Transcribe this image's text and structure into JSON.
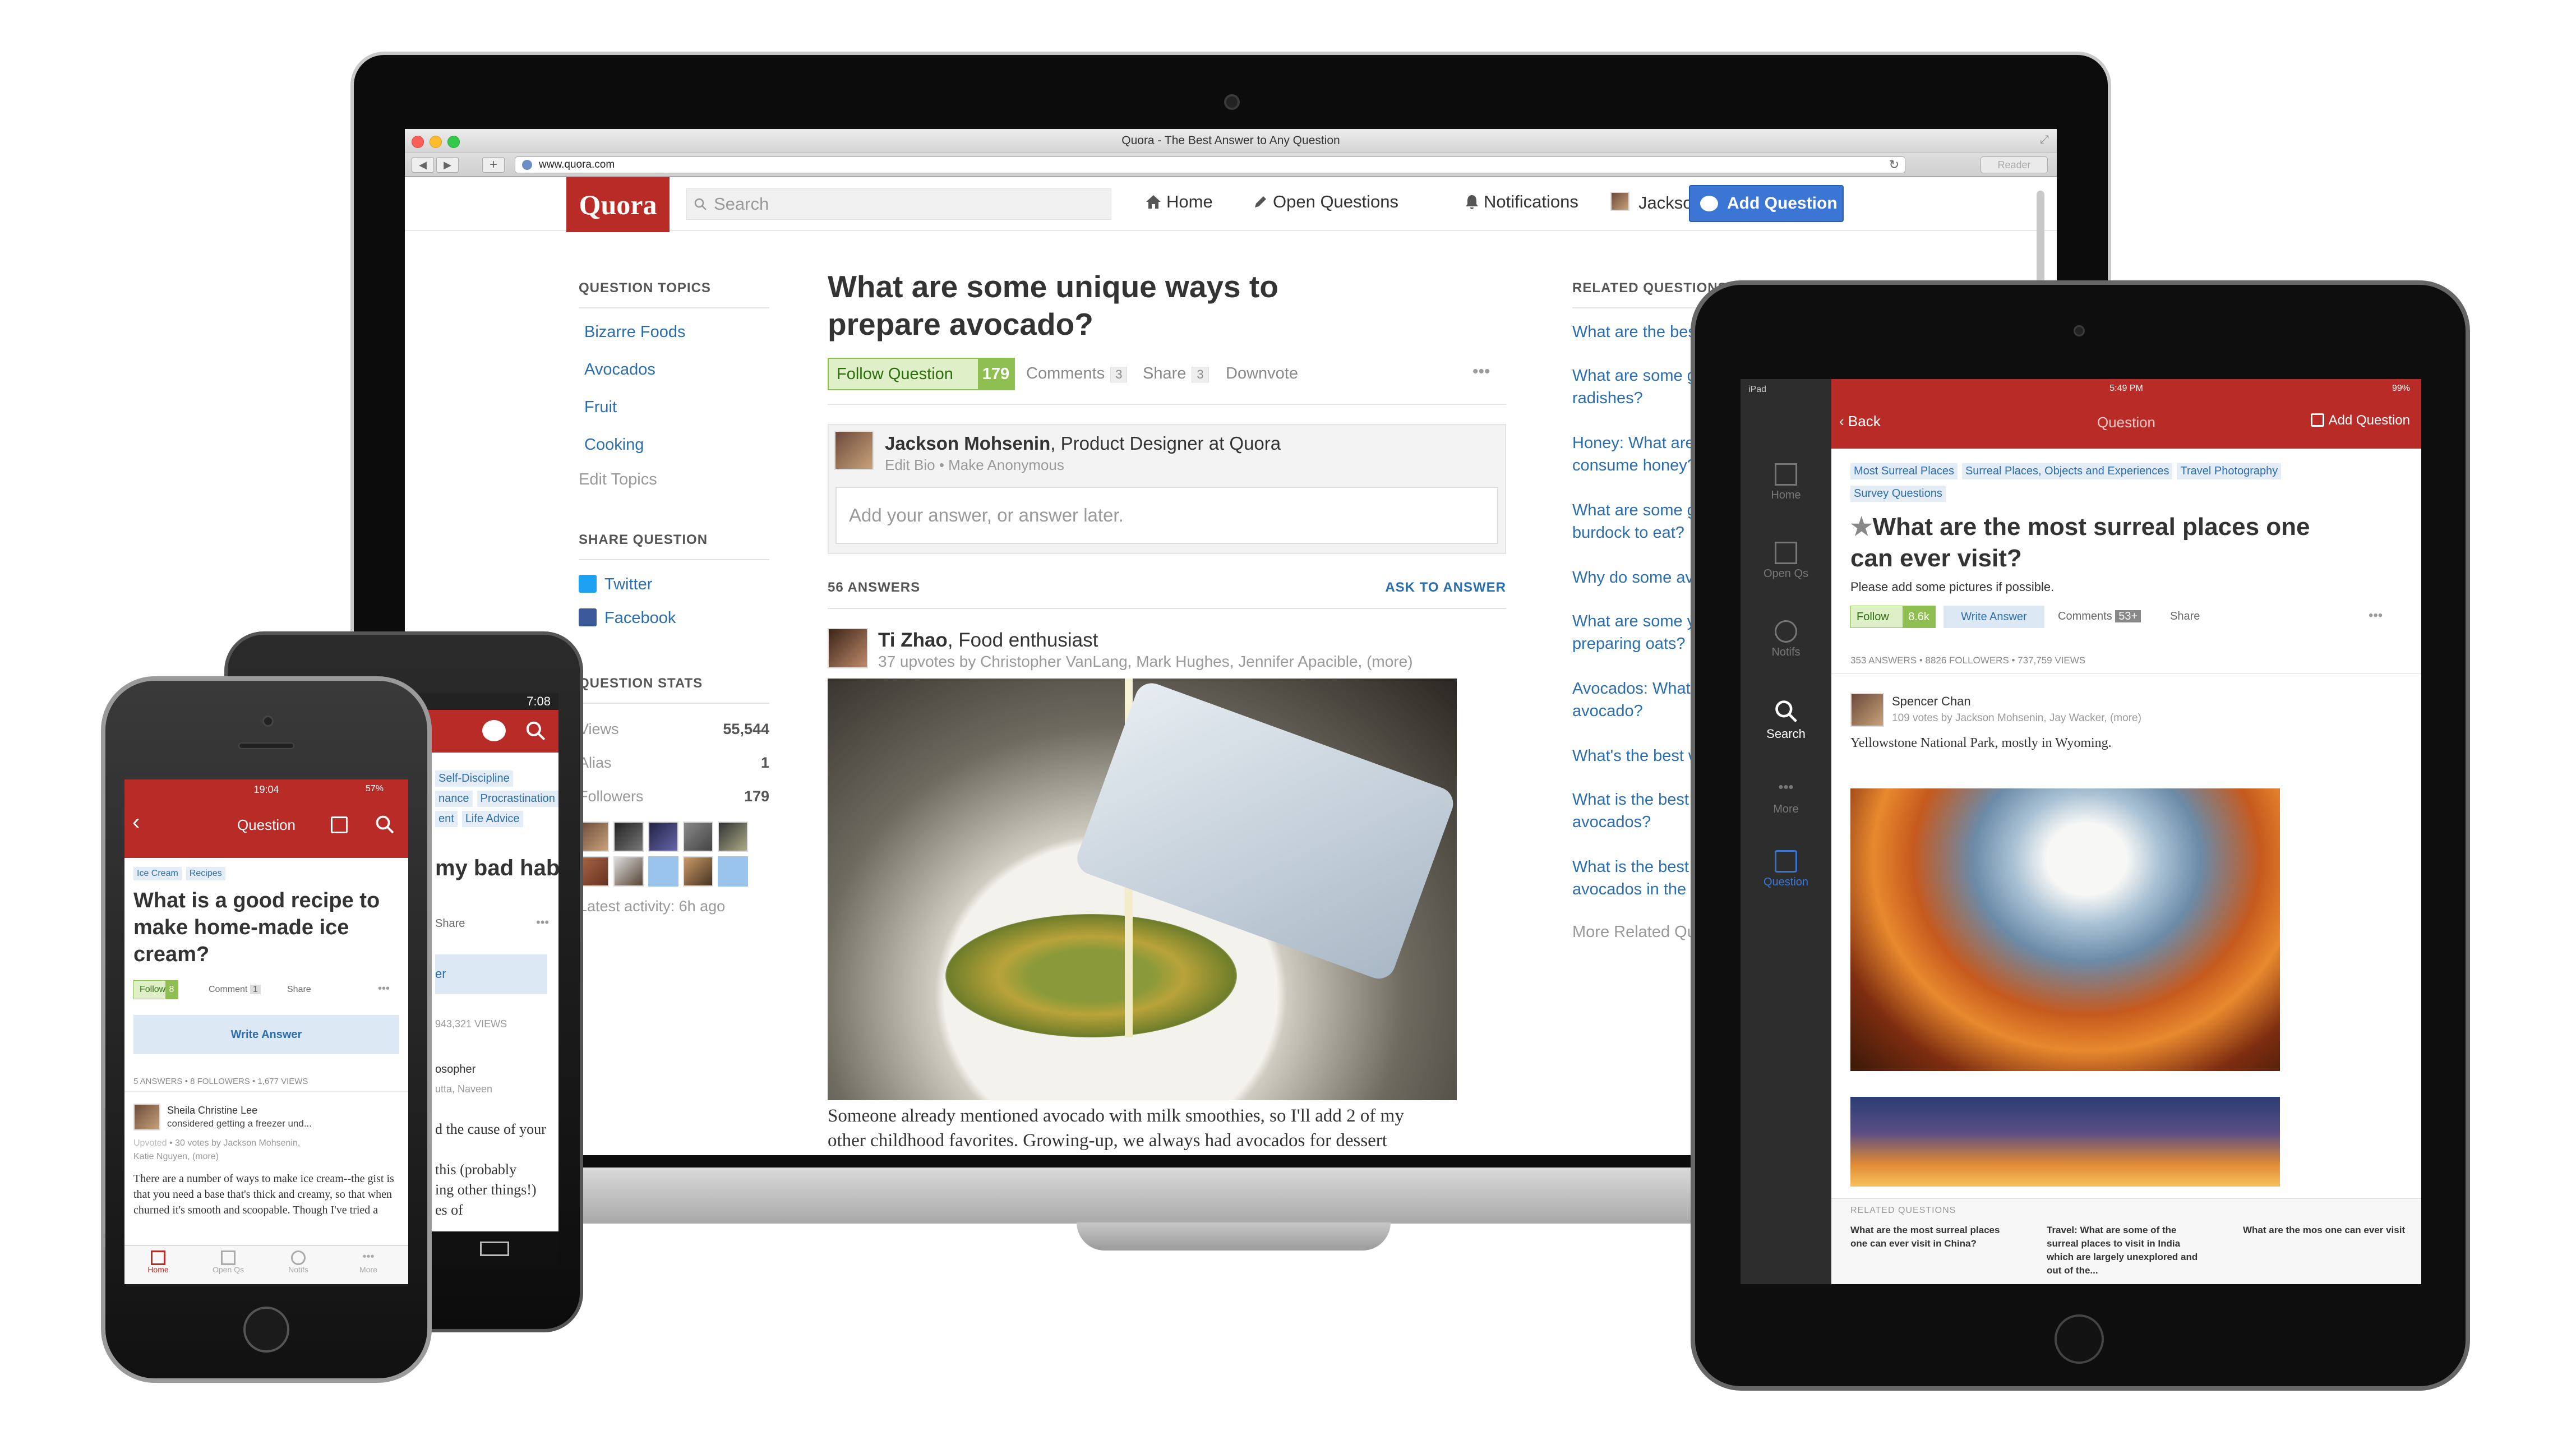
{
  "laptop": {
    "window_title": "Quora - The Best Answer to Any Question",
    "url": "www.quora.com",
    "reader": "Reader",
    "header": {
      "logo": "Quora",
      "search_placeholder": "Search",
      "nav_home": "Home",
      "nav_open_questions": "Open Questions",
      "nav_notifications": "Notifications",
      "nav_user": "Jackson",
      "add_question": "Add Question"
    },
    "left_sidebar": {
      "topics_heading": "QUESTION TOPICS",
      "topics": [
        "Bizarre Foods",
        "Avocados",
        "Fruit",
        "Cooking"
      ],
      "edit_topics": "Edit Topics",
      "share_heading": "SHARE QUESTION",
      "share_twitter": "Twitter",
      "share_facebook": "Facebook",
      "stats_heading": "QUESTION STATS",
      "stats": [
        {
          "label": "Views",
          "value": "55,544"
        },
        {
          "label": "Alias",
          "value": "1"
        },
        {
          "label": "Followers",
          "value": "179"
        }
      ],
      "latest_activity": "Latest activity: 6h ago"
    },
    "question": {
      "title": "What are some unique ways to prepare avocado?",
      "follow_label": "Follow Question",
      "follow_count": "179",
      "comments_label": "Comments",
      "comments_count": "3",
      "share_label": "Share",
      "share_count": "3",
      "downvote_label": "Downvote",
      "more": "•••"
    },
    "answer_editor": {
      "author_name": "Jackson Mohsenin",
      "author_role": ", Product Designer at Quora",
      "edit_bio": "Edit Bio • Make Anonymous",
      "placeholder": "Add your answer, or answer later."
    },
    "answers": {
      "count_label": "56 ANSWERS",
      "ask_to_answer": "ASK TO ANSWER",
      "first": {
        "author": "Ti Zhao",
        "role": ", Food enthusiast",
        "upvotes": "37 upvotes by Christopher VanLang, Mark Hughes, Jennifer Apacible, (more)",
        "text_line1": "Someone already mentioned avocado with milk smoothies, so I'll add 2 of my",
        "text_line2": "other childhood favorites. Growing-up, we always had avocados for dessert"
      }
    },
    "related": {
      "heading": "RELATED QUESTIONS",
      "items": [
        "What are the best",
        "What are some go radishes?",
        "Honey: What are s consume honey?",
        "What are some go burdock to eat?",
        "Why do some avo",
        "What are some yu preparing oats?",
        "Avocados: What is an avocado?",
        "What's the best w",
        "What is the best w avocados?",
        "What is the best w avocados in the re"
      ],
      "more": "More Related Que"
    }
  },
  "android": {
    "time": "7:08",
    "tags": [
      "Self-Discipline",
      "nance",
      "Procrastination",
      "ent",
      "Life Advice"
    ],
    "title_fragment": "my bad habit",
    "share": "Share",
    "more": "•••",
    "write_fragment": "er",
    "views_fragment": "943,321 VIEWS",
    "author_fragment": "osopher",
    "voters_fragment": "utta, Naveen",
    "text_lines": [
      "d the cause of your",
      "",
      "this (probably",
      "ing other things!)",
      "es of"
    ]
  },
  "iphone": {
    "time": "19:04",
    "battery": "57%",
    "header_title": "Question",
    "tags": [
      "Ice Cream",
      "Recipes"
    ],
    "title": "What is a good recipe to make home-made ice cream?",
    "follow": "Follow",
    "follow_count": "8",
    "comment": "Comment",
    "comment_count": "1",
    "share": "Share",
    "more": "•••",
    "write_answer": "Write Answer",
    "stats": "5 ANSWERS • 8 FOLLOWERS • 1,677 VIEWS",
    "author": "Sheila Christine Lee",
    "author_bio": "considered getting a freezer und...",
    "upvoted": "Upvoted",
    "votes": "• 30 votes by Jackson Mohsenin,",
    "votes2": "Katie Nguyen, (more)",
    "answer_text": "There are a number of ways to make ice cream--the gist is that you need a base that's thick and creamy, so that when churned it's smooth and scoopable. Though I've tried a",
    "tabs": [
      "Home",
      "Open Qs",
      "Notifs",
      "More"
    ]
  },
  "ipad": {
    "carrier": "iPad",
    "time": "5:49 PM",
    "battery": "99%",
    "back": "Back",
    "header_title": "Question",
    "add_question": "Add Question",
    "sidebar": [
      "Home",
      "Open Qs",
      "Notifs",
      "Search",
      "More",
      "Question"
    ],
    "tags": [
      "Most Surreal Places",
      "Surreal Places, Objects and Experiences",
      "Travel Photography",
      "Survey Questions"
    ],
    "title": "What are the most surreal places one can ever visit?",
    "subtitle": "Please add some pictures if possible.",
    "follow": "Follow",
    "follow_count": "8.6k",
    "write_answer": "Write Answer",
    "comments": "Comments",
    "comments_count": "53+",
    "share": "Share",
    "more": "•••",
    "stats": "353 ANSWERS • 8826 FOLLOWERS • 737,759 VIEWS",
    "author": "Spencer Chan",
    "votes": "109 votes by Jackson Mohsenin, Jay Wacker, (more)",
    "answer_text": "Yellowstone National Park, mostly in Wyoming.",
    "related_heading": "RELATED QUESTIONS",
    "related": [
      "What are the most surreal places one can ever visit in China?",
      "Travel: What are some of the surreal places to visit in India which are largely unexplored and out of the...",
      "What are the mos one can ever visit"
    ]
  },
  "colors": {
    "quora_red": "#b92b27",
    "link_blue": "#2b6dad",
    "follow_green": "#8fbf50",
    "add_question_blue": "#3b76d4"
  }
}
